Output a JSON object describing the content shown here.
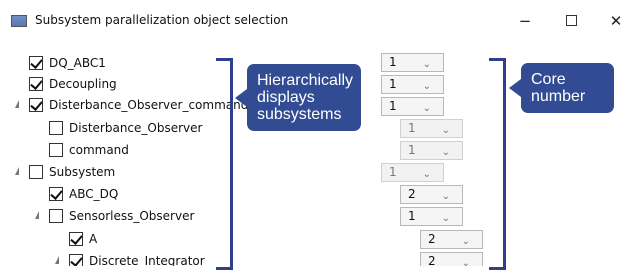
{
  "window": {
    "title": "Subsystem parallelization object selection",
    "minimize_glyph": "−",
    "close_glyph": "✕"
  },
  "tree": [
    {
      "label": "DQ_ABC1",
      "checked": true,
      "expander": false
    },
    {
      "label": "Decoupling",
      "checked": true,
      "expander": false
    },
    {
      "label": "Disterbance_Observer_command",
      "checked": true,
      "expander": true
    },
    {
      "label": "Disterbance_Observer",
      "checked": false,
      "expander": false
    },
    {
      "label": "command",
      "checked": false,
      "expander": false
    },
    {
      "label": "Subsystem",
      "checked": false,
      "expander": true
    },
    {
      "label": "ABC_DQ",
      "checked": true,
      "expander": false
    },
    {
      "label": "Sensorless_Observer",
      "checked": false,
      "expander": true
    },
    {
      "label": "A",
      "checked": true,
      "expander": false
    },
    {
      "label": "Discrete_Integrator",
      "checked": true,
      "expander": true
    }
  ],
  "core_numbers": [
    {
      "value": "1",
      "enabled": true
    },
    {
      "value": "1",
      "enabled": true
    },
    {
      "value": "1",
      "enabled": true
    },
    {
      "value": "1",
      "enabled": false
    },
    {
      "value": "1",
      "enabled": false
    },
    {
      "value": "1",
      "enabled": false
    },
    {
      "value": "2",
      "enabled": true
    },
    {
      "value": "1",
      "enabled": true
    },
    {
      "value": "2",
      "enabled": true
    },
    {
      "value": "2",
      "enabled": true
    }
  ],
  "callouts": {
    "hierarchy": "Hierarchically displays subsystems",
    "core": "Core number"
  },
  "colors": {
    "annotation": "#324c94",
    "bracket": "#2f3f8c"
  }
}
